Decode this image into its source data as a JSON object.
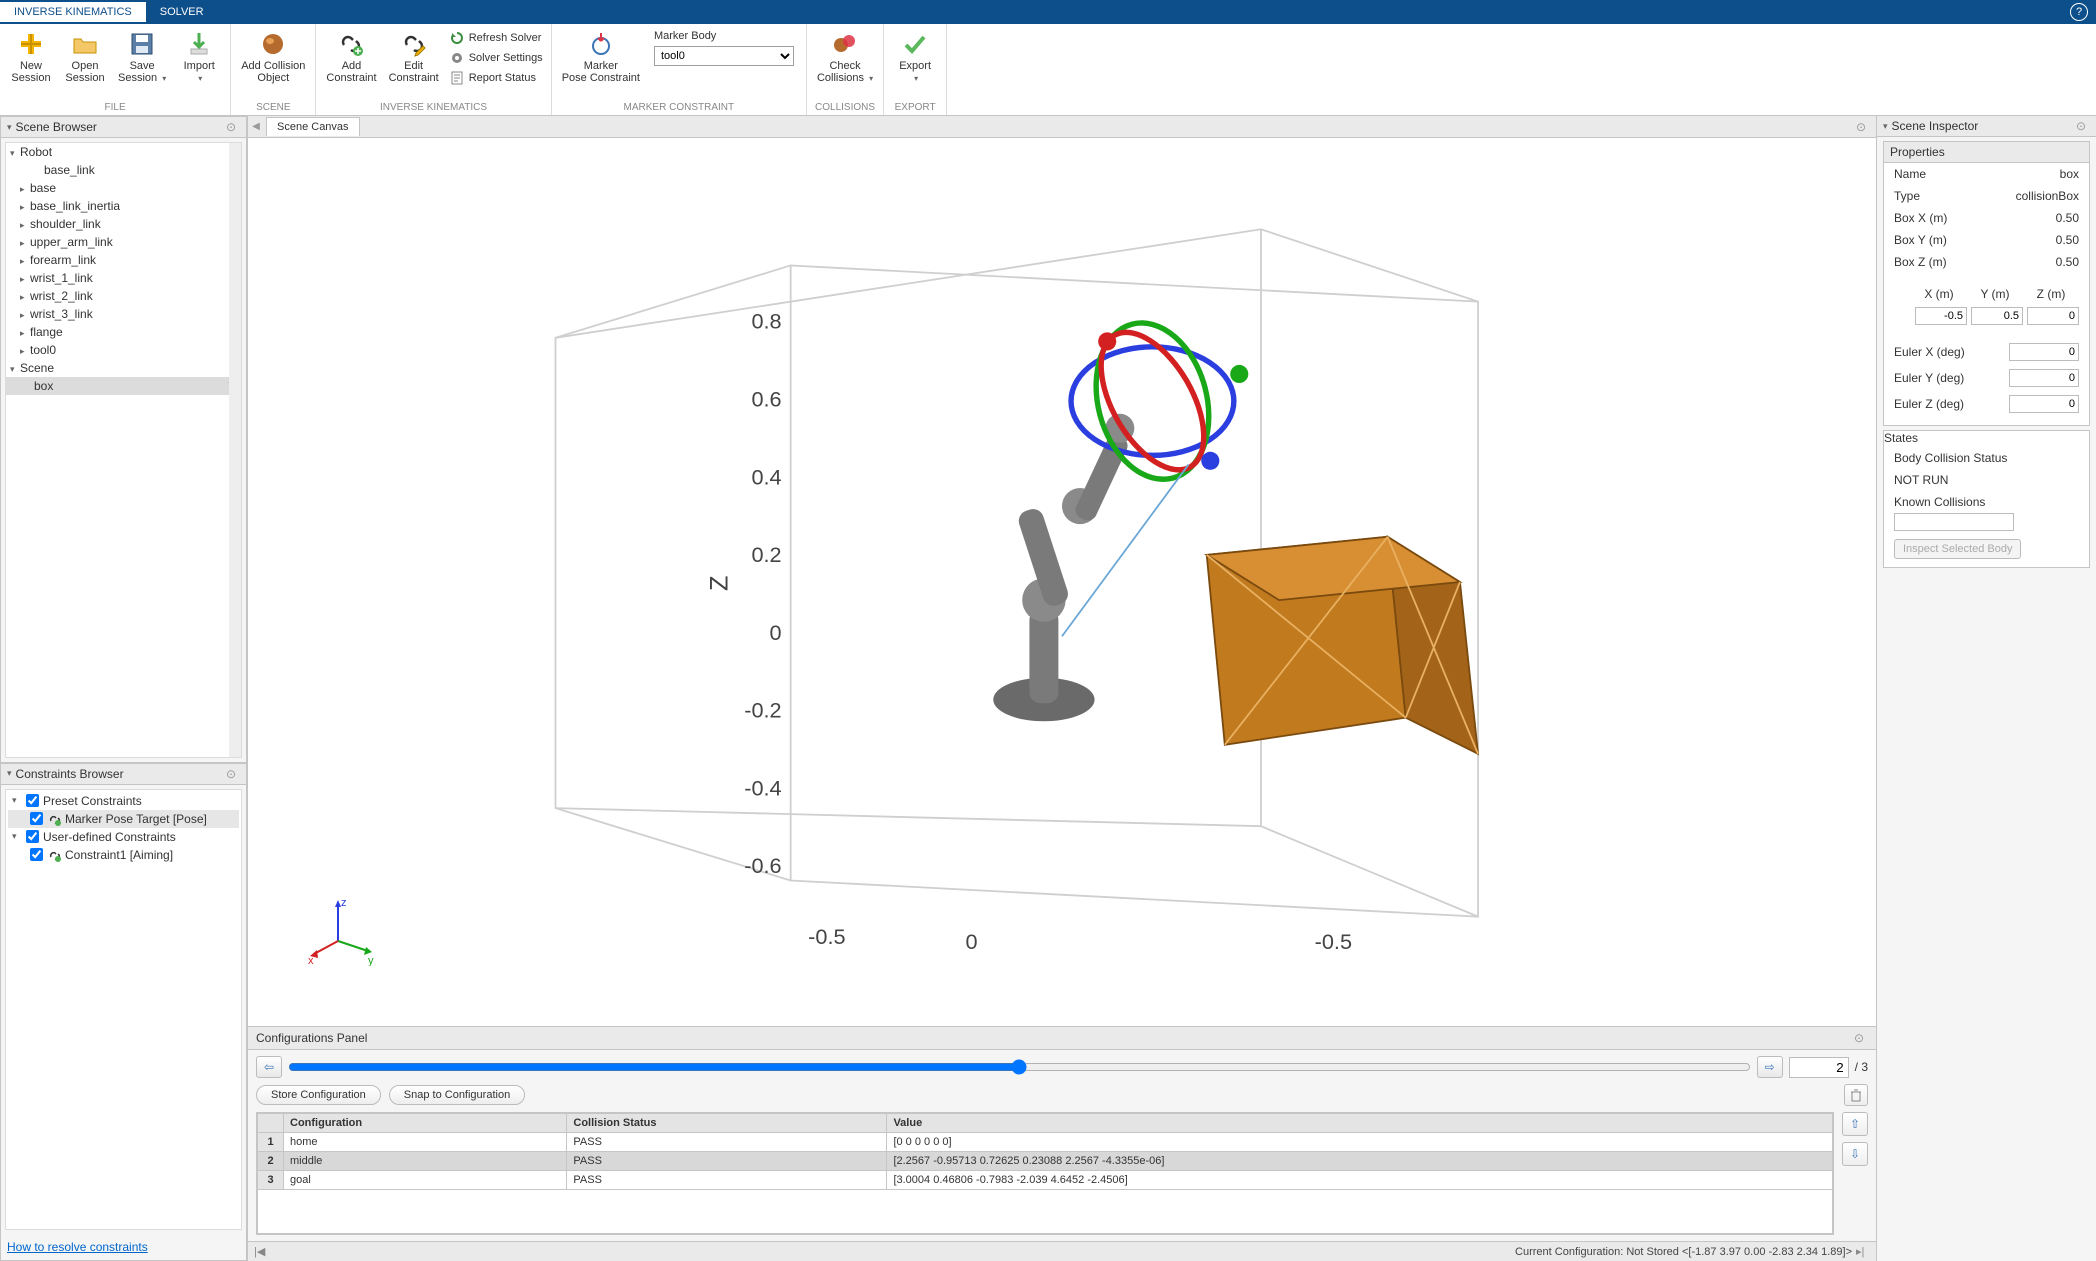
{
  "tabs": {
    "t0": "INVERSE KINEMATICS",
    "t1": "SOLVER"
  },
  "ribbon": {
    "file": {
      "label": "FILE",
      "new": "New\nSession",
      "open": "Open\nSession",
      "save": "Save\nSession",
      "import": "Import"
    },
    "scene": {
      "label": "SCENE",
      "addcol": "Add Collision\nObject"
    },
    "ik": {
      "label": "INVERSE KINEMATICS",
      "addcon": "Add\nConstraint",
      "editcon": "Edit\nConstraint",
      "refresh": "Refresh Solver",
      "settings": "Solver Settings",
      "report": "Report Status"
    },
    "marker": {
      "label": "MARKER CONSTRAINT",
      "mpc": "Marker\nPose Constraint",
      "bodylabel": "Marker Body",
      "bodyvalue": "tool0"
    },
    "collisions": {
      "label": "COLLISIONS",
      "check": "Check\nCollisions"
    },
    "export": {
      "label": "EXPORT",
      "export": "Export"
    }
  },
  "sceneBrowser": {
    "title": "Scene Browser",
    "robot": "Robot",
    "nodes": [
      "base_link",
      "base",
      "base_link_inertia",
      "shoulder_link",
      "upper_arm_link",
      "forearm_link",
      "wrist_1_link",
      "wrist_2_link",
      "wrist_3_link",
      "flange",
      "tool0"
    ],
    "scene": "Scene",
    "box": "box"
  },
  "constraintsBrowser": {
    "title": "Constraints Browser",
    "preset": "Preset Constraints",
    "presetItem": "Marker Pose Target [Pose]",
    "user": "User-defined Constraints",
    "userItem": "Constraint1 [Aiming]",
    "help": "How to resolve constraints"
  },
  "canvasTab": "Scene Canvas",
  "axisTicks": {
    "z": [
      "0.8",
      "0.6",
      "0.4",
      "0.2",
      "0",
      "-0.2",
      "-0.4",
      "-0.6"
    ],
    "x": [
      "-0.5",
      "0",
      "-0.5"
    ]
  },
  "axisLabels": {
    "x": "x",
    "y": "y",
    "z": "z",
    "Z": "Z"
  },
  "configPanel": {
    "title": "Configurations Panel",
    "page": "2",
    "pageOf": "/ 3",
    "store": "Store Configuration",
    "snap": "Snap to Configuration",
    "cols": {
      "c0": "Configuration",
      "c1": "Collision Status",
      "c2": "Value"
    },
    "rows": [
      {
        "n": "1",
        "cfg": "home",
        "cs": "PASS",
        "val": "[0 0 0 0 0 0]"
      },
      {
        "n": "2",
        "cfg": "middle",
        "cs": "PASS",
        "val": "[2.2567 -0.95713 0.72625 0.23088 2.2567 -4.3355e-06]"
      },
      {
        "n": "3",
        "cfg": "goal",
        "cs": "PASS",
        "val": "[3.0004 0.46806 -0.7983 -2.039 4.6452 -2.4506]"
      }
    ]
  },
  "statusbar": "Current Configuration: Not Stored <[-1.87 3.97 0.00 -2.83 2.34 1.89]>",
  "inspector": {
    "title": "Scene Inspector",
    "propsTitle": "Properties",
    "name_k": "Name",
    "name_v": "box",
    "type_k": "Type",
    "type_v": "collisionBox",
    "bx_k": "Box X (m)",
    "bx_v": "0.50",
    "by_k": "Box Y (m)",
    "by_v": "0.50",
    "bz_k": "Box Z (m)",
    "bz_v": "0.50",
    "xh": "X (m)",
    "yh": "Y (m)",
    "zh": "Z (m)",
    "x": " -0.5",
    "y": "0.5",
    "z": "0",
    "ex_k": "Euler X (deg)",
    "ex_v": "0",
    "ey_k": "Euler Y (deg)",
    "ey_v": "0",
    "ez_k": "Euler Z (deg)",
    "ez_v": "0",
    "statesTitle": "States",
    "bcs": "Body Collision Status",
    "notrun": "NOT RUN",
    "kc": "Known Collisions",
    "inspectBtn": "Inspect Selected Body"
  }
}
